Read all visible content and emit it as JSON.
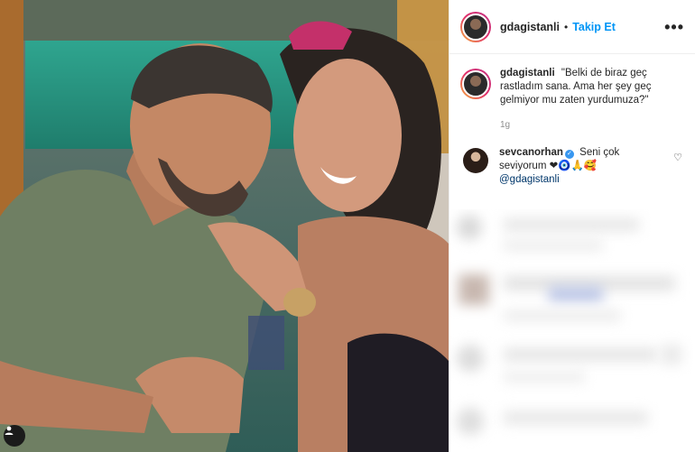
{
  "post": {
    "username": "gdagistanli",
    "separator": "•",
    "follow_label": "Takip Et",
    "more_label": "•••",
    "caption_username": "gdagistanli",
    "caption_text": "\"Belki de biraz geç rastladım sana. Ama her şey geç gelmiyor mu zaten yurdumuza?\"",
    "caption_time": "1g"
  },
  "comment": {
    "username": "sevcanorhan",
    "text": "Seni çok seviyorum",
    "emojis": "❤🧿🙏🥰",
    "mention": "@gdagistanli"
  },
  "icons": {
    "more": "more-options-icon",
    "verified": "verified-badge-icon",
    "like": "heart-icon",
    "tagged_user": "user-tag-icon"
  },
  "colors": {
    "follow_blue": "#0095f6",
    "mention_blue": "#00376b",
    "verified_blue": "#3897f0",
    "meta_gray": "#8e8e8e"
  }
}
